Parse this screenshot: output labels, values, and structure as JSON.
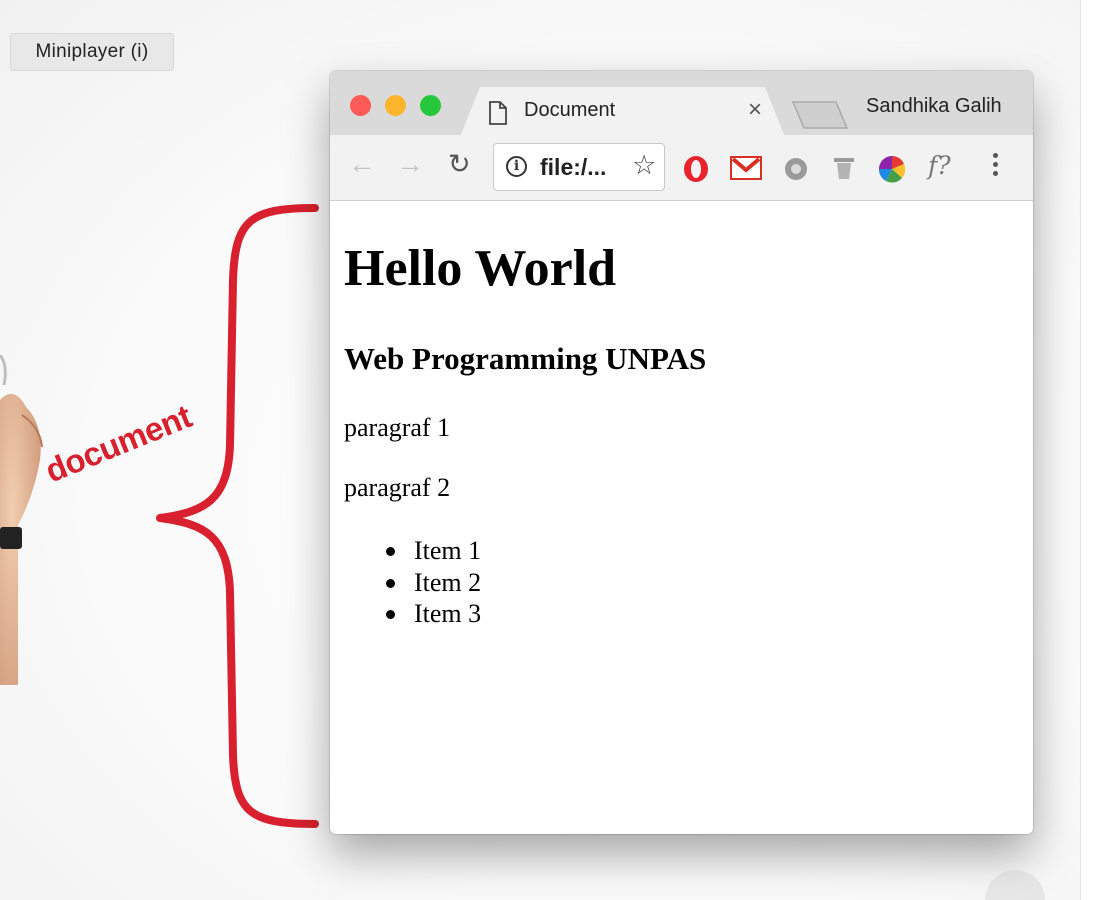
{
  "overlay": {
    "miniplayer_label": "Miniplayer (i)",
    "annotation_label": "document",
    "annotation_color": "#d8202e"
  },
  "browser": {
    "tab": {
      "title": "Document",
      "icon": "document-icon",
      "close_icon": "close-icon"
    },
    "profile_name": "Sandhika Galih",
    "toolbar": {
      "back_icon": "arrow-left-icon",
      "forward_icon": "arrow-right-icon",
      "reload_icon": "reload-icon",
      "url": "file:/...",
      "info_icon": "info-icon",
      "bookmark_icon": "star-icon",
      "extensions": [
        "opera-icon",
        "gmail-icon",
        "gear-extension-icon",
        "trash-icon",
        "color-wheel-icon",
        "font-finder-icon"
      ],
      "font_finder_label": "f?",
      "menu_icon": "more-vertical-icon"
    }
  },
  "page": {
    "heading": "Hello World",
    "subheading": "Web Programming UNPAS",
    "paragraphs": [
      "paragraf 1",
      "paragraf 2"
    ],
    "list_items": [
      "Item 1",
      "Item 2",
      "Item 3"
    ]
  }
}
